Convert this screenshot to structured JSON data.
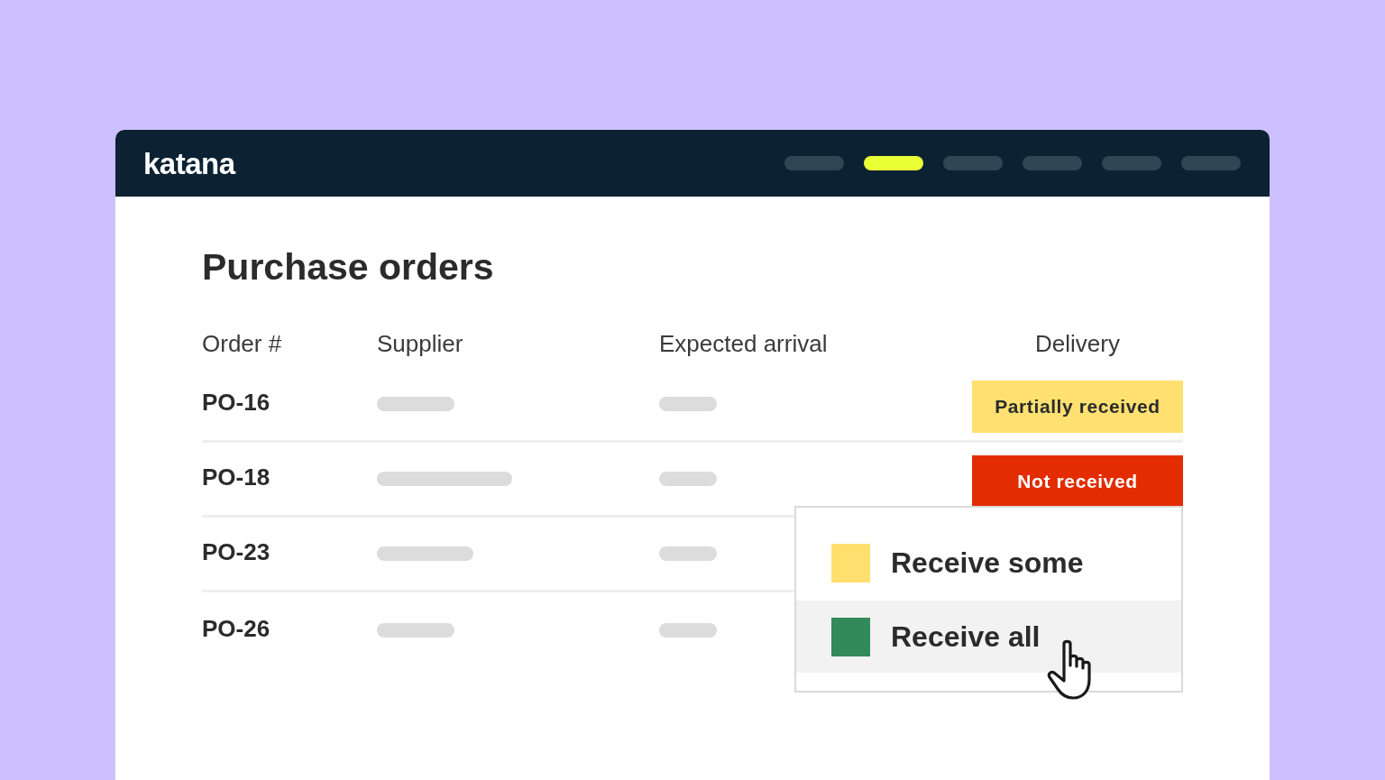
{
  "top_bar": {
    "logo": "katana",
    "nav": [
      {
        "selected": false
      },
      {
        "selected": true
      },
      {
        "selected": false
      },
      {
        "selected": false
      },
      {
        "selected": false
      },
      {
        "selected": false
      }
    ]
  },
  "title": "Purchase orders",
  "table": {
    "columns": [
      "Order #",
      "Supplier",
      "Expected arrival",
      "Delivery"
    ],
    "rows": [
      {
        "order": "PO-16",
        "delivery": {
          "label": "Partially received",
          "color": "#ffe070"
        }
      },
      {
        "order": "PO-18",
        "delivery": {
          "label": "Not received",
          "color": "#e32c00"
        }
      },
      {
        "order": "PO-23"
      },
      {
        "order": "PO-26"
      }
    ]
  },
  "menu": {
    "items": [
      {
        "label": "Receive some",
        "color": "#ffdf6e",
        "highlighted": false
      },
      {
        "label": "Receive all",
        "color": "#318a5a",
        "highlighted": true
      }
    ]
  }
}
